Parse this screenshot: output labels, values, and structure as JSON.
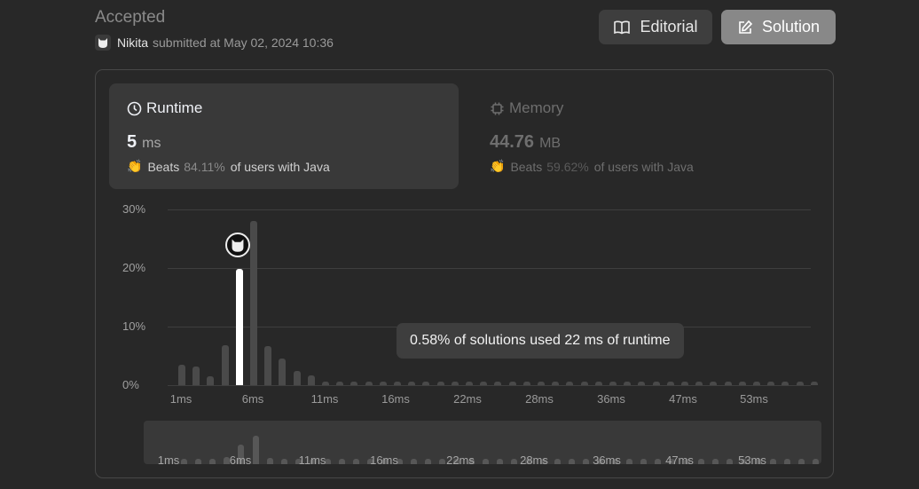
{
  "submission": {
    "status": "Accepted",
    "user": "Nikita",
    "submitted_text": "submitted at May 02, 2024 10:36"
  },
  "buttons": {
    "editorial": "Editorial",
    "solution": "Solution"
  },
  "runtime": {
    "title": "Runtime",
    "value": "5",
    "unit": "ms",
    "beats_label": "Beats",
    "beats_pct": "84.11%",
    "beats_suffix": "of users with Java"
  },
  "memory": {
    "title": "Memory",
    "value": "44.76",
    "unit": "MB",
    "beats_label": "Beats",
    "beats_pct": "59.62%",
    "beats_suffix": "of users with Java"
  },
  "tooltip": "0.58% of solutions used 22 ms of runtime",
  "colors": {
    "bar": "#4a4a4a",
    "highlight": "#ffffff",
    "accent_bg": "#393939"
  },
  "chart_data": {
    "type": "bar",
    "y_tick_labels": [
      "30%",
      "20%",
      "10%",
      "0%"
    ],
    "y_ticks": [
      30,
      20,
      10,
      0
    ],
    "x_tick_labels": [
      "1ms",
      "6ms",
      "11ms",
      "16ms",
      "22ms",
      "28ms",
      "36ms",
      "47ms",
      "53ms"
    ],
    "ylim": [
      0,
      30
    ],
    "grid": true,
    "highlight_index": 5,
    "values": [
      3.5,
      3.2,
      1.5,
      6.8,
      19.8,
      28.0,
      6.6,
      4.5,
      2.4,
      1.6,
      0.6,
      0.6,
      0.6,
      0.6,
      0.6,
      0.6,
      0.6,
      0.6,
      0.6,
      0.6,
      0.6,
      0.6,
      0.6,
      0.6,
      0.6,
      0.6,
      0.6,
      0.6,
      0.6,
      0.6,
      0.6,
      0.6,
      0.6,
      0.6,
      0.6,
      0.6,
      0.6,
      0.6,
      0.6,
      0.6,
      0.6,
      0.6,
      0.6,
      0.6,
      0.6
    ]
  },
  "minimap": {
    "x_tick_labels": [
      "1ms",
      "6ms",
      "11ms",
      "16ms",
      "22ms",
      "28ms",
      "36ms",
      "47ms",
      "53ms"
    ]
  }
}
